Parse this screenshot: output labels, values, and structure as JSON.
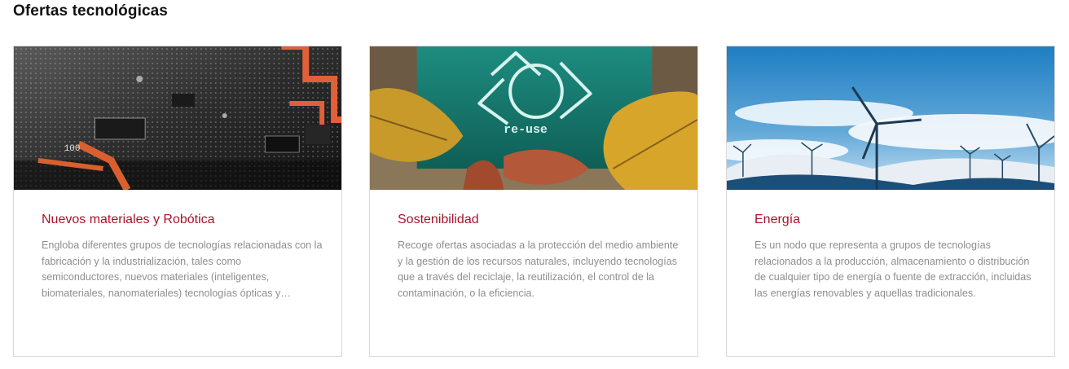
{
  "section": {
    "title": "Ofertas tecnológicas"
  },
  "cards": [
    {
      "title": "Nuevos materiales y Robótica",
      "description": "Engloba diferentes grupos de tecnologías relacionadas con la fabricación y la industrialización, tales como semiconductores, nuevos materiales (inteligentes, biomateriales, nanomateriales) tecnologías ópticas y robótica.",
      "image_text": "100"
    },
    {
      "title": "Sostenibilidad",
      "description": "Recoge ofertas asociadas a la protección del medio ambiente y la gestión de los recursos naturales, incluyendo tecnologías que a través del reciclaje, la reutilización, el control de la contaminación, o la eficiencia.",
      "image_text": "re-use"
    },
    {
      "title": "Energía",
      "description": "Es un nodo que representa a grupos de tecnologías relacionados a la producción, almacenamiento o distribución de cualquier tipo de energía o fuente de extracción, incluidas las energías renovables y aquellas tradicionales."
    }
  ],
  "colors": {
    "title_accent": "#a8132a",
    "description": "#8e8e8e",
    "border": "#d9d9d9"
  }
}
